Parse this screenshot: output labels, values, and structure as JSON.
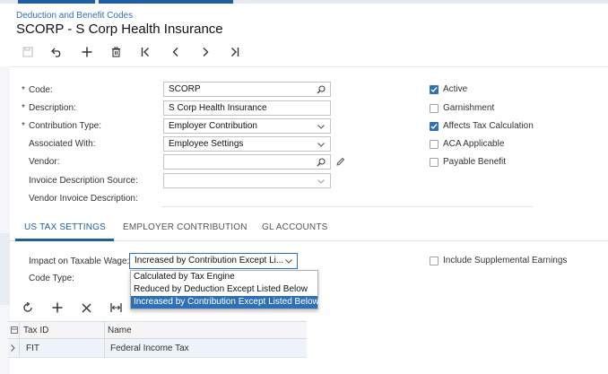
{
  "breadcrumb": "Deduction and Benefit Codes",
  "title": "SCORP - S Corp Health Insurance",
  "toolbar": {
    "icons": [
      "save-icon",
      "undo-icon",
      "add-icon",
      "delete-icon",
      "first-record-icon",
      "previous-record-icon",
      "next-record-icon",
      "last-record-icon"
    ]
  },
  "form": {
    "code": {
      "label": "Code:",
      "value": "SCORP"
    },
    "description": {
      "label": "Description:",
      "value": "S Corp Health Insurance"
    },
    "contribution_type": {
      "label": "Contribution Type:",
      "value": "Employer Contribution"
    },
    "associated_with": {
      "label": "Associated With:",
      "value": "Employee Settings"
    },
    "vendor": {
      "label": "Vendor:",
      "value": ""
    },
    "invoice_description_source": {
      "label": "Invoice Description Source:",
      "value": ""
    },
    "vendor_invoice_description": {
      "label": "Vendor Invoice Description:",
      "value": ""
    },
    "required_mark": "*"
  },
  "checkboxes": {
    "active": {
      "label": "Active",
      "checked": true
    },
    "garnishment": {
      "label": "Garnishment",
      "checked": false
    },
    "affects_tax": {
      "label": "Affects Tax Calculation",
      "checked": true
    },
    "aca": {
      "label": "ACA Applicable",
      "checked": false
    },
    "payable_benefit": {
      "label": "Payable Benefit",
      "checked": false
    },
    "include_supplemental": {
      "label": "Include Supplemental Earnings",
      "checked": false
    }
  },
  "tabs": [
    {
      "label": "US TAX SETTINGS",
      "active": true
    },
    {
      "label": "EMPLOYER CONTRIBUTION",
      "active": false
    },
    {
      "label": "GL ACCOUNTS",
      "active": false
    }
  ],
  "tax_settings": {
    "impact_label": "Impact on Taxable Wage:",
    "impact_value": "Increased by Contribution Except Li...",
    "code_type_label": "Code Type:",
    "options": [
      {
        "label": "Calculated by Tax Engine",
        "highlighted": false
      },
      {
        "label": "Reduced by Deduction Except Listed Below",
        "highlighted": false
      },
      {
        "label": "Increased by Contribution Except Listed Below",
        "highlighted": true
      }
    ]
  },
  "grid": {
    "toolbar_icons": [
      "refresh-icon",
      "add-row-icon",
      "delete-row-icon",
      "fit-columns-icon"
    ],
    "columns": [
      "Tax ID",
      "Name"
    ],
    "rows": [
      {
        "tax_id": "FIT",
        "name": "Federal Income Tax"
      }
    ]
  },
  "colors": {
    "accent": "#2f6fb6",
    "tab_active": "#1f5fa0",
    "row_highlight": "#eef3f9"
  }
}
